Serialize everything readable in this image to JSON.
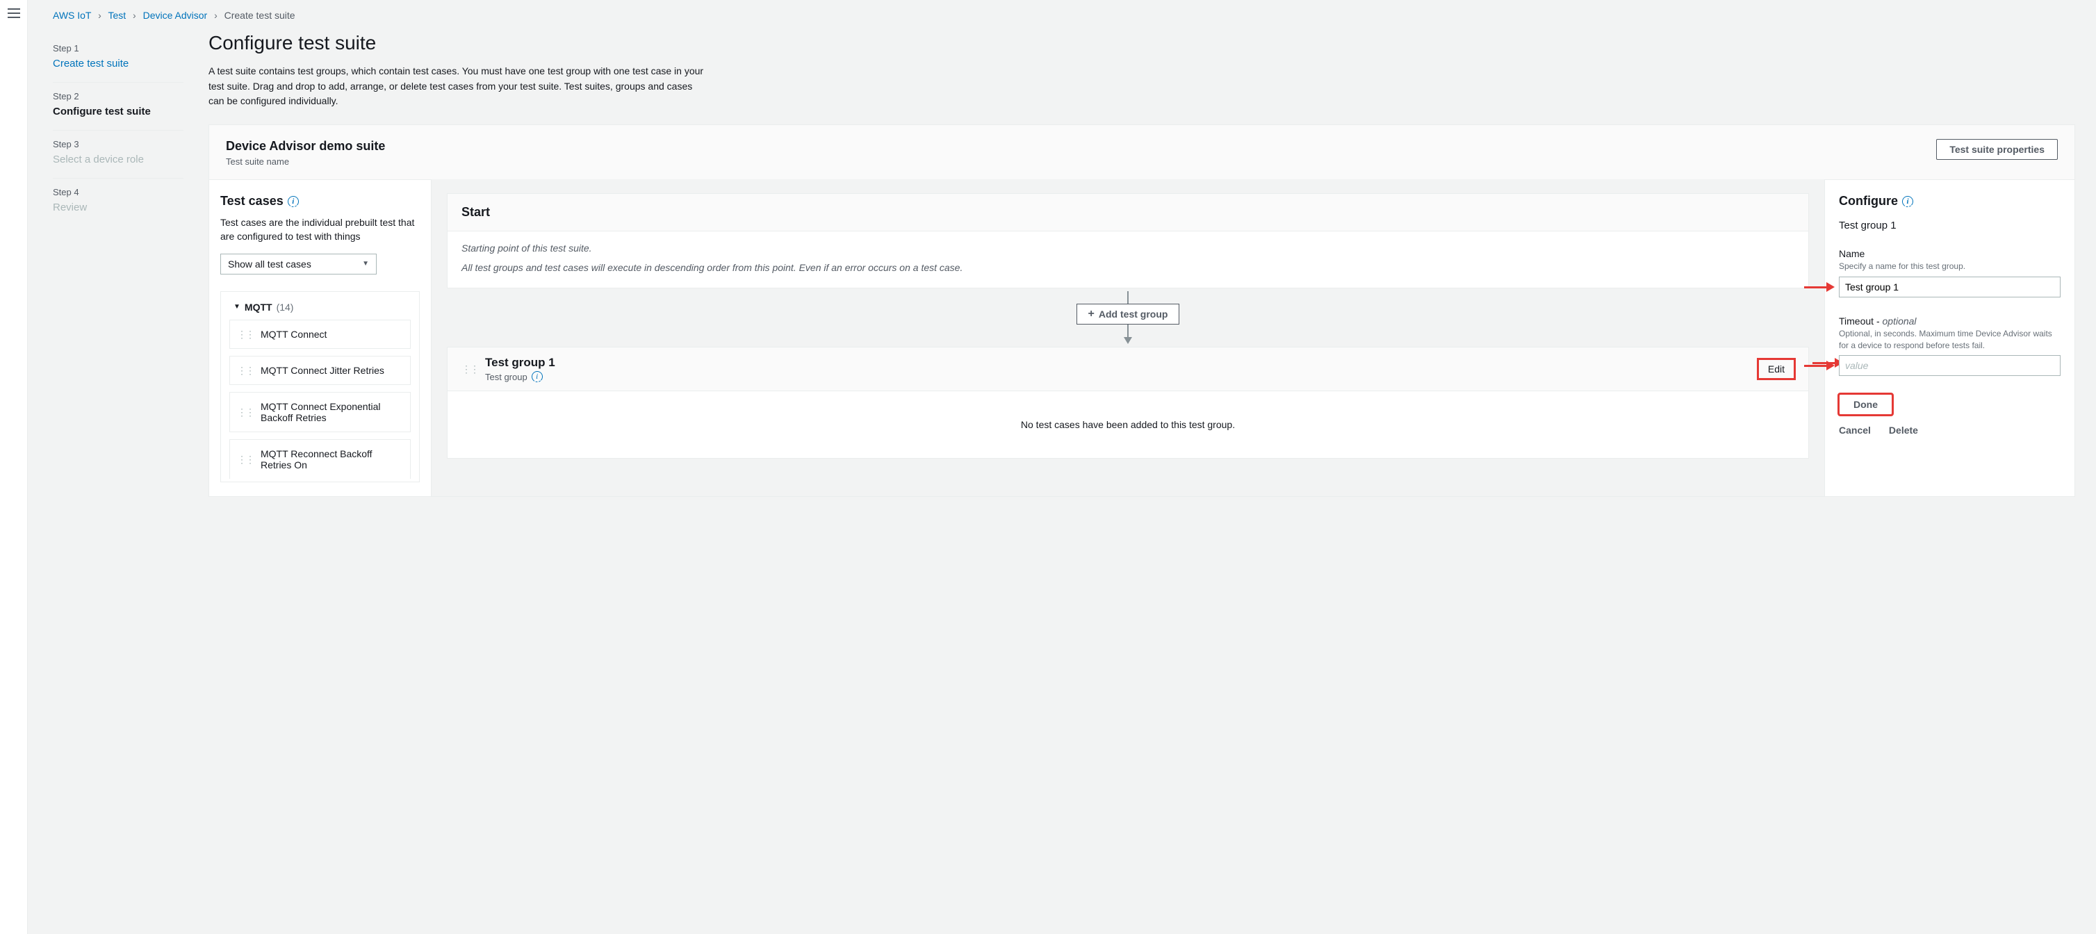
{
  "breadcrumb": {
    "items": [
      "AWS IoT",
      "Test",
      "Device Advisor"
    ],
    "current": "Create test suite"
  },
  "sidebar": {
    "steps": [
      {
        "label": "Step 1",
        "title": "Create test suite",
        "state": "link"
      },
      {
        "label": "Step 2",
        "title": "Configure test suite",
        "state": "active"
      },
      {
        "label": "Step 3",
        "title": "Select a device role",
        "state": "disabled"
      },
      {
        "label": "Step 4",
        "title": "Review",
        "state": "disabled"
      }
    ]
  },
  "page": {
    "title": "Configure test suite",
    "description": "A test suite contains test groups, which contain test cases. You must have one test group with one test case in your test suite. Drag and drop to add, arrange, or delete test cases from your test suite. Test suites, groups and cases can be configured individually."
  },
  "suite": {
    "name": "Device Advisor demo suite",
    "sub": "Test suite name",
    "properties_button": "Test suite properties"
  },
  "testcases": {
    "heading": "Test cases",
    "description": "Test cases are the individual prebuilt test that are configured to test with things",
    "filter_selected": "Show all test cases",
    "category": {
      "name": "MQTT",
      "count": "(14)",
      "items": [
        "MQTT Connect",
        "MQTT Connect Jitter Retries",
        "MQTT Connect Exponential Backoff Retries",
        "MQTT Reconnect Backoff Retries On"
      ]
    }
  },
  "flow": {
    "start_title": "Start",
    "start_line1": "Starting point of this test suite.",
    "start_line2": "All test groups and test cases will execute in descending order from this point. Even if an error occurs on a test case.",
    "add_group_label": "Add test group",
    "group": {
      "title": "Test group 1",
      "sub": "Test group",
      "edit": "Edit",
      "empty": "No test cases have been added to this test group."
    }
  },
  "configure": {
    "heading": "Configure",
    "context": "Test group 1",
    "name": {
      "label": "Name",
      "help": "Specify a name for this test group.",
      "value": "Test group 1"
    },
    "timeout": {
      "label_main": "Timeout - ",
      "label_optional": "optional",
      "help": "Optional, in seconds. Maximum time Device Advisor waits for a device to respond before tests fail.",
      "placeholder": "value"
    },
    "done": "Done",
    "cancel": "Cancel",
    "delete": "Delete"
  }
}
